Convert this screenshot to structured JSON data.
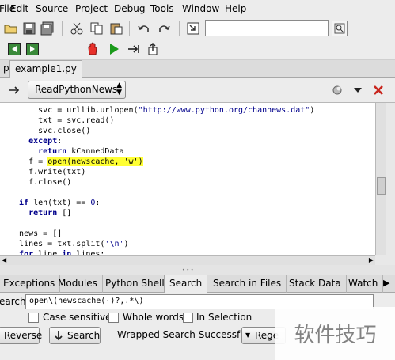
{
  "menubar": {
    "items": [
      "File",
      "Edit",
      "Source",
      "Project",
      "Debug",
      "Tools",
      "Window",
      "Help"
    ],
    "mnemonics": [
      "F",
      "E",
      "S",
      "P",
      "D",
      "T",
      "W",
      "H"
    ]
  },
  "toolbar": {
    "search_value": "",
    "icons": [
      "open-folder-icon",
      "save-icon",
      "save-all-icon",
      "cut-icon",
      "copy-icon",
      "paste-icon",
      "undo-icon",
      "redo-icon",
      "goto-icon",
      "find-icon",
      "back-icon",
      "forward-icon",
      "stop-icon",
      "run-icon",
      "step-into-icon",
      "step-out-icon"
    ]
  },
  "file_tabs": {
    "partial": "p",
    "active": "example1.py"
  },
  "editor": {
    "function_selector": "ReadPythonNews",
    "code_lines": [
      {
        "indent": "      ",
        "parts": [
          {
            "t": "svc = urllib.urlopen(",
            "c": ""
          },
          {
            "t": "\"http://www.python.org/channews.dat\"",
            "c": "str"
          },
          {
            "t": ")",
            "c": ""
          }
        ]
      },
      {
        "indent": "      ",
        "parts": [
          {
            "t": "txt = svc.read()",
            "c": ""
          }
        ]
      },
      {
        "indent": "      ",
        "parts": [
          {
            "t": "svc.close()",
            "c": ""
          }
        ]
      },
      {
        "indent": "    ",
        "parts": [
          {
            "t": "except",
            "c": "kw"
          },
          {
            "t": ":",
            "c": ""
          }
        ]
      },
      {
        "indent": "      ",
        "parts": [
          {
            "t": "return",
            "c": "kw"
          },
          {
            "t": " kCannedData",
            "c": ""
          }
        ]
      },
      {
        "indent": "    ",
        "parts": [
          {
            "t": "f = ",
            "c": ""
          },
          {
            "t": "open(newscache, 'w')",
            "c": "hl"
          }
        ]
      },
      {
        "indent": "    ",
        "parts": [
          {
            "t": "f.write(txt)",
            "c": ""
          }
        ]
      },
      {
        "indent": "    ",
        "parts": [
          {
            "t": "f.close()",
            "c": ""
          }
        ]
      },
      {
        "indent": "",
        "parts": []
      },
      {
        "indent": "  ",
        "parts": [
          {
            "t": "if",
            "c": "kw"
          },
          {
            "t": " len(txt) == ",
            "c": ""
          },
          {
            "t": "0",
            "c": "str"
          },
          {
            "t": ":",
            "c": ""
          }
        ]
      },
      {
        "indent": "    ",
        "parts": [
          {
            "t": "return",
            "c": "kw"
          },
          {
            "t": " []",
            "c": ""
          }
        ]
      },
      {
        "indent": "",
        "parts": []
      },
      {
        "indent": "  ",
        "parts": [
          {
            "t": "news = []",
            "c": ""
          }
        ]
      },
      {
        "indent": "  ",
        "parts": [
          {
            "t": "lines = txt.split(",
            "c": ""
          },
          {
            "t": "'\\n'",
            "c": "str"
          },
          {
            "t": ")",
            "c": ""
          }
        ]
      },
      {
        "indent": "  ",
        "parts": [
          {
            "t": "for",
            "c": "kw"
          },
          {
            "t": " line ",
            "c": ""
          },
          {
            "t": "in",
            "c": "kw"
          },
          {
            "t": " lines:",
            "c": ""
          }
        ]
      }
    ]
  },
  "bottom_tabs": [
    "Exceptions",
    "Modules",
    "Python Shell",
    "Search",
    "Search in Files",
    "Stack Data",
    "Watch"
  ],
  "bottom_tab_active": "Search",
  "search": {
    "label": "earch:",
    "value": "open\\(newscache(·)?,.*\\)",
    "options": [
      {
        "label": "Case sensitive",
        "checked": false
      },
      {
        "label": "Whole words",
        "checked": false
      },
      {
        "label": "In Selection",
        "checked": false
      }
    ],
    "buttons": {
      "reverse": "Reverse",
      "search": "Search",
      "regex": "Rege"
    },
    "status": "Wrapped Search Successf"
  },
  "watermark": "软件技巧",
  "colors": {
    "highlight": "#ffff33",
    "keyword": "#00008b",
    "run_green": "#1a9a1a",
    "close_red": "#c8261e"
  }
}
